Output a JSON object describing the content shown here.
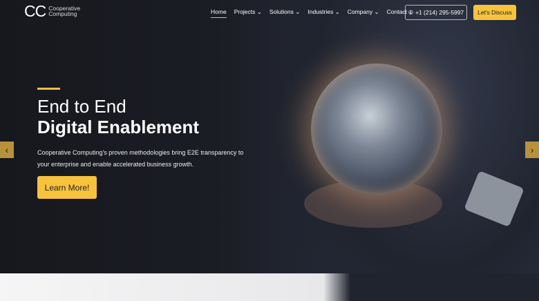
{
  "brand": {
    "mark": "CC",
    "name_line1": "Cooperative",
    "name_line2": "Computing"
  },
  "nav": [
    {
      "label": "Home",
      "active": true
    },
    {
      "label": "Projects",
      "dropdown": true
    },
    {
      "label": "Solutions",
      "dropdown": true
    },
    {
      "label": "Industries",
      "dropdown": true
    },
    {
      "label": "Company",
      "dropdown": true
    },
    {
      "label": "Contact",
      "dropdown": true
    }
  ],
  "header": {
    "phone": "+1 (214) 295-5997",
    "phone_icon": "phone-icon",
    "cta": "Let's Discuss"
  },
  "hero": {
    "title_line1": "End to End",
    "title_line2": "Digital Enablement",
    "description": "Cooperative Computing's proven methodologies bring E2E transparency to your enterprise and enable accelerated business growth.",
    "button": "Learn More!"
  },
  "carousel": {
    "prev": "‹",
    "next": "›"
  },
  "colors": {
    "accent": "#f7c23c",
    "background": "#16181f"
  }
}
